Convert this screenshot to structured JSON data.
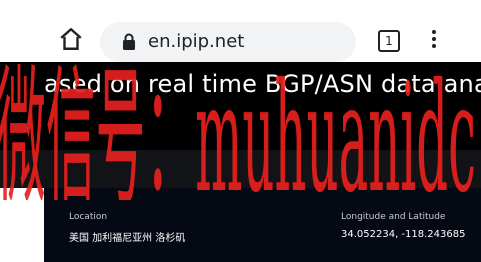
{
  "browser": {
    "url": "en.ipip.net",
    "tab_count": "1",
    "icons": [
      "home-icon",
      "lock-icon",
      "tab-switcher-icon",
      "more-menu-icon"
    ]
  },
  "hero": {
    "text": "ased on real time BGP/ASN data analy"
  },
  "location": {
    "label": "Location",
    "value": "美国 加利福尼亚州 洛杉矶"
  },
  "coords": {
    "label": "Longitude and Latitude",
    "value": "34.052234, -118.243685"
  },
  "watermark": {
    "text": "微信号：muhuanidc",
    "color": "#e8211e"
  }
}
